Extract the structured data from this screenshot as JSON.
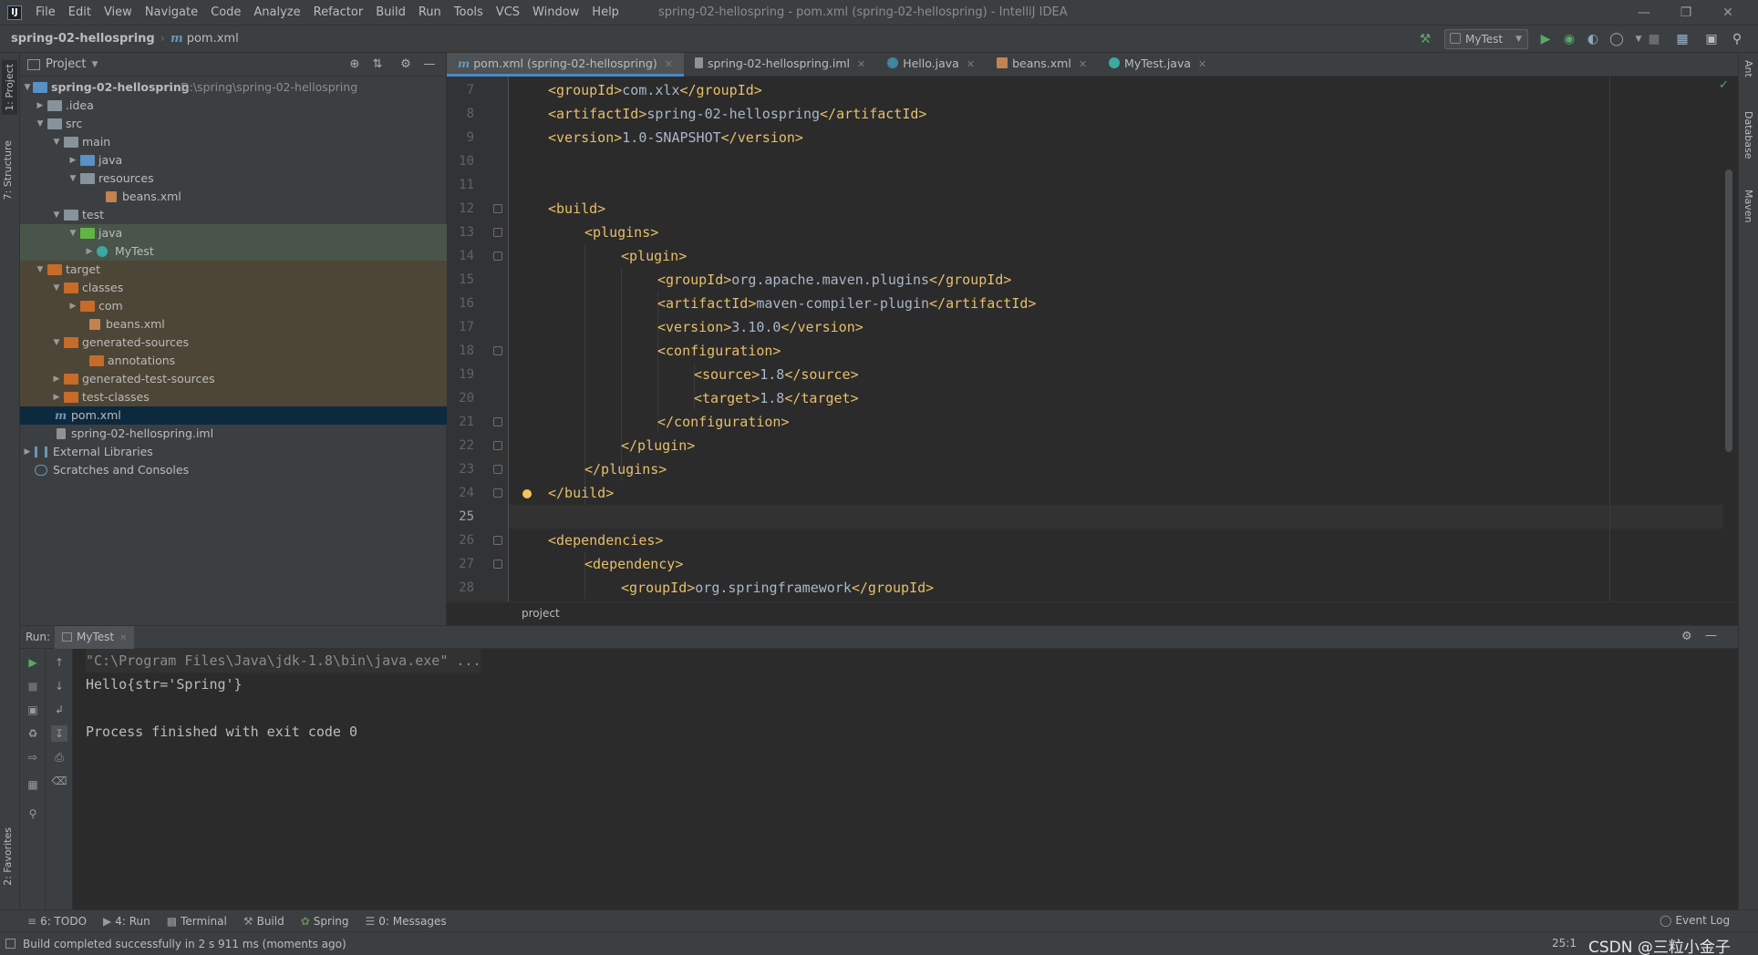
{
  "titlebar": {
    "menu": [
      "File",
      "Edit",
      "View",
      "Navigate",
      "Code",
      "Analyze",
      "Refactor",
      "Build",
      "Run",
      "Tools",
      "VCS",
      "Window",
      "Help"
    ],
    "title": "spring-02-hellospring - pom.xml (spring-02-hellospring) - IntelliJ IDEA",
    "logo": "IJ"
  },
  "navbar": {
    "project": "spring-02-hellospring",
    "file": "pom.xml",
    "run_config": "MyTest"
  },
  "left_strip": {
    "project_tab": "1: Project",
    "structure_tab": "7: Structure",
    "favorites_tab": "2: Favorites"
  },
  "right_strip": {
    "ant": "Ant",
    "database": "Database",
    "maven": "Maven"
  },
  "project_panel": {
    "title": "Project",
    "tree": [
      {
        "label": "spring-02-hellospring",
        "path": "D:\\spring\\spring-02-hellospring"
      },
      {
        "label": ".idea"
      },
      {
        "label": "src"
      },
      {
        "label": "main"
      },
      {
        "label": "java"
      },
      {
        "label": "resources"
      },
      {
        "label": "beans.xml"
      },
      {
        "label": "test"
      },
      {
        "label": "java"
      },
      {
        "label": "MyTest"
      },
      {
        "label": "target"
      },
      {
        "label": "classes"
      },
      {
        "label": "com"
      },
      {
        "label": "beans.xml"
      },
      {
        "label": "generated-sources"
      },
      {
        "label": "annotations"
      },
      {
        "label": "generated-test-sources"
      },
      {
        "label": "test-classes"
      },
      {
        "label": "pom.xml"
      },
      {
        "label": "spring-02-hellospring.iml"
      },
      {
        "label": "External Libraries"
      },
      {
        "label": "Scratches and Consoles"
      }
    ]
  },
  "editor": {
    "tabs": [
      {
        "label": "pom.xml (spring-02-hellospring)",
        "active": true
      },
      {
        "label": "spring-02-hellospring.iml"
      },
      {
        "label": "Hello.java"
      },
      {
        "label": "beans.xml"
      },
      {
        "label": "MyTest.java"
      }
    ],
    "lines": [
      {
        "n": "7",
        "tag_open": "<groupId>",
        "text": "com.xlx",
        "tag_close": "</groupId>"
      },
      {
        "n": "8",
        "tag_open": "<artifactId>",
        "text": "spring-02-hellospring",
        "tag_close": "</artifactId>"
      },
      {
        "n": "9",
        "tag_open": "<version>",
        "text": "1.0-SNAPSHOT",
        "tag_close": "</version>"
      },
      {
        "n": "10",
        "tag_open": "",
        "text": "",
        "tag_close": ""
      },
      {
        "n": "11",
        "tag_open": "",
        "text": "",
        "tag_close": ""
      },
      {
        "n": "12",
        "tag_open": "<build>",
        "text": "",
        "tag_close": ""
      },
      {
        "n": "13",
        "tag_open": "<plugins>",
        "text": "",
        "tag_close": ""
      },
      {
        "n": "14",
        "tag_open": "<plugin>",
        "text": "",
        "tag_close": ""
      },
      {
        "n": "15",
        "tag_open": "<groupId>",
        "text": "org.apache.maven.plugins",
        "tag_close": "</groupId>"
      },
      {
        "n": "16",
        "tag_open": "<artifactId>",
        "text": "maven-compiler-plugin",
        "tag_close": "</artifactId>"
      },
      {
        "n": "17",
        "tag_open": "<version>",
        "text": "3.10.0",
        "tag_close": "</version>"
      },
      {
        "n": "18",
        "tag_open": "<configuration>",
        "text": "",
        "tag_close": ""
      },
      {
        "n": "19",
        "tag_open": "<source>",
        "text": "1.8",
        "tag_close": "</source>"
      },
      {
        "n": "20",
        "tag_open": "<target>",
        "text": "1.8",
        "tag_close": "</target>"
      },
      {
        "n": "21",
        "tag_open": "</configuration>",
        "text": "",
        "tag_close": ""
      },
      {
        "n": "22",
        "tag_open": "</plugin>",
        "text": "",
        "tag_close": ""
      },
      {
        "n": "23",
        "tag_open": "</plugins>",
        "text": "",
        "tag_close": ""
      },
      {
        "n": "24",
        "tag_open": "</build>",
        "text": "",
        "tag_close": ""
      },
      {
        "n": "25",
        "tag_open": "",
        "text": "",
        "tag_close": ""
      },
      {
        "n": "26",
        "tag_open": "<dependencies>",
        "text": "",
        "tag_close": ""
      },
      {
        "n": "27",
        "tag_open": "<dependency>",
        "text": "",
        "tag_close": ""
      },
      {
        "n": "28",
        "tag_open": "<groupId>",
        "text": "org.springframework",
        "tag_close": "</groupId>"
      }
    ],
    "breadcrumb": "project"
  },
  "run_panel": {
    "label": "Run:",
    "tab": "MyTest",
    "console": [
      "\"C:\\Program Files\\Java\\jdk-1.8\\bin\\java.exe\" ...",
      "Hello{str='Spring'}",
      "",
      "Process finished with exit code 0"
    ]
  },
  "bottom_tools": [
    "6: TODO",
    "4: Run",
    "Terminal",
    "Build",
    "Spring",
    "0: Messages"
  ],
  "event_log": "Event Log",
  "status": {
    "text": "Build completed successfully in 2 s 911 ms (moments ago)",
    "position": "25:1",
    "watermark": "CSDN @三粒小金子"
  },
  "colors": {
    "tag": "#e8bf6a",
    "text": "#a9b7c6",
    "accent": "#4a88c7",
    "run_green": "#59a869"
  }
}
